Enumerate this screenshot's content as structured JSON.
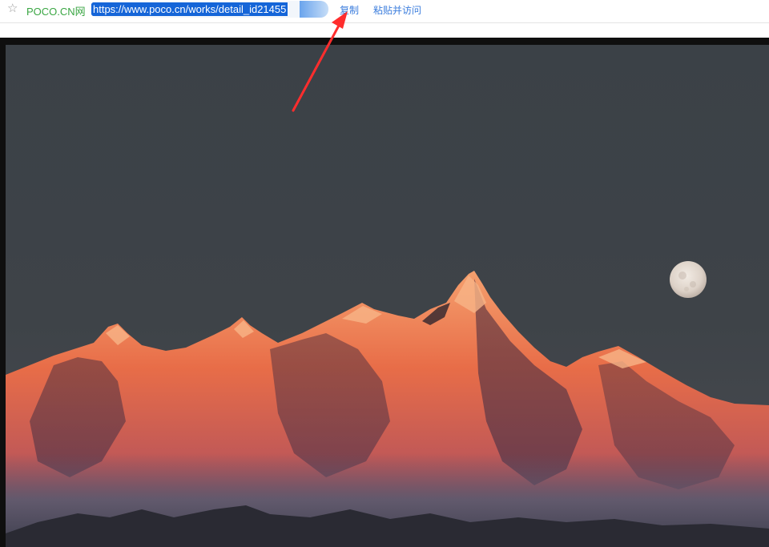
{
  "browser_bar": {
    "favorite_icon": "star-icon",
    "site_name": "POCO.CN网",
    "url": "https://www.poco.cn/works/detail_id21455",
    "copy_label": "复制",
    "paste_visit_label": "粘贴并访问"
  },
  "photo": {
    "subject": "mountain-range-alpenglow-with-moon",
    "colors": {
      "sky": "#3c4248",
      "peaks": "#e9704a",
      "moon": "#e8e0d8"
    }
  },
  "annotation": {
    "arrow_color": "#ff2d2d"
  }
}
